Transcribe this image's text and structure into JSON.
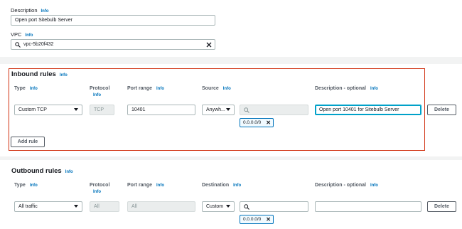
{
  "top": {
    "description_label": "Description",
    "description_info": "Info",
    "description_value": "Open port Sitebulb Server",
    "vpc_label": "VPC",
    "vpc_info": "Info",
    "vpc_value": "vpc-5b20f432"
  },
  "inbound": {
    "title": "Inbound rules",
    "title_info": "Info",
    "col_type": "Type",
    "col_protocol": "Protocol",
    "col_port_range": "Port range",
    "col_source": "Source",
    "col_description": "Description - optional",
    "info": "Info",
    "row": {
      "type": "Custom TCP",
      "protocol": "TCP",
      "port_range": "10401",
      "source": "Anywh...",
      "source_search": "",
      "token": "0.0.0.0/0",
      "description": "Open port 10401 for Sitebulb Server",
      "delete_label": "Delete"
    },
    "add_rule_label": "Add rule"
  },
  "outbound": {
    "title": "Outbound rules",
    "title_info": "Info",
    "col_type": "Type",
    "col_protocol": "Protocol",
    "col_port_range": "Port range",
    "col_destination": "Destination",
    "col_description": "Description - optional",
    "info": "Info",
    "row": {
      "type": "All traffic",
      "protocol": "All",
      "port_range": "All",
      "destination": "Custom",
      "destination_search": "",
      "token": "0.0.0.0/0",
      "description": "",
      "delete_label": "Delete"
    }
  },
  "colors": {
    "accent": "#0073bb",
    "highlight_border": "#d13212",
    "focus": "#00a1c9"
  }
}
